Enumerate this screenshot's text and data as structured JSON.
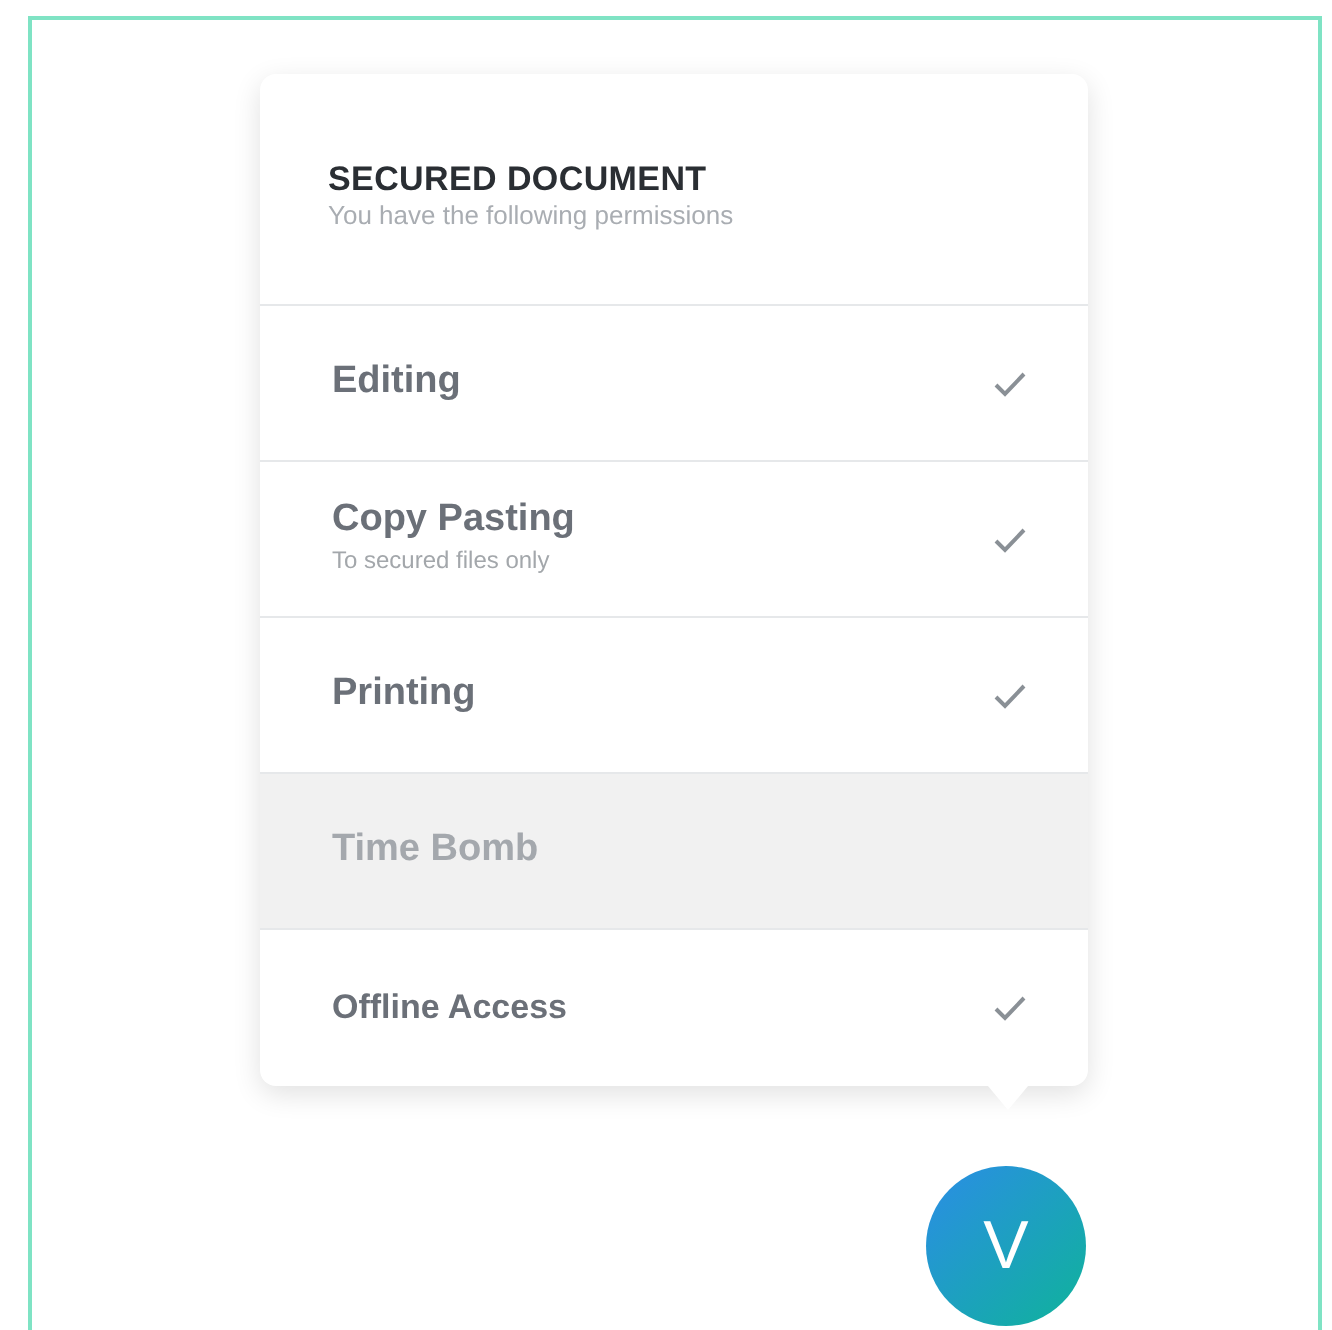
{
  "popover": {
    "title": "SECURED DOCUMENT",
    "subtitle": "You have the following permissions",
    "permissions": [
      {
        "label": "Editing",
        "granted": true,
        "kind": "large"
      },
      {
        "label": "Copy Pasting",
        "note": "To secured files only",
        "granted": true,
        "kind": "large"
      },
      {
        "label": "Printing",
        "granted": true,
        "kind": "large"
      },
      {
        "label": "Time Bomb",
        "granted": false,
        "kind": "large"
      },
      {
        "label": "Offline Access",
        "granted": true,
        "kind": "small"
      }
    ]
  },
  "launcher": {
    "label": "V"
  }
}
